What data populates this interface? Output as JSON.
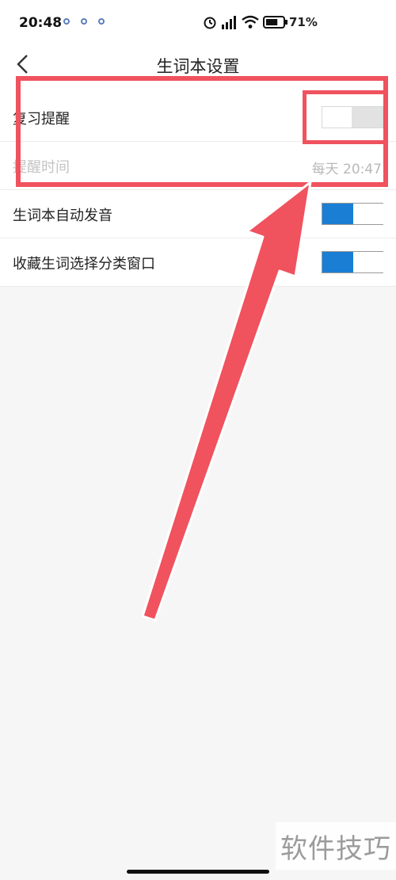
{
  "statusbar": {
    "time": "20:48",
    "battery_percent": "71%",
    "battery_level": 0.71
  },
  "header": {
    "title": "生词本设置",
    "back_icon": "chevron-left-icon"
  },
  "settings": [
    {
      "label": "复习提醒",
      "type": "toggle",
      "on": false
    },
    {
      "label": "提醒时间",
      "type": "value",
      "value": "每天 20:47",
      "disabled": true
    },
    {
      "label": "生词本自动发音",
      "type": "toggle",
      "on": true
    },
    {
      "label": "收藏生词选择分类窗口",
      "type": "toggle",
      "on": true
    }
  ],
  "annotation": {
    "color": "#f0525e"
  },
  "watermark": {
    "text": "软件技巧"
  },
  "colors": {
    "accent": "#1a7fd4",
    "background": "#f6f6f6"
  }
}
